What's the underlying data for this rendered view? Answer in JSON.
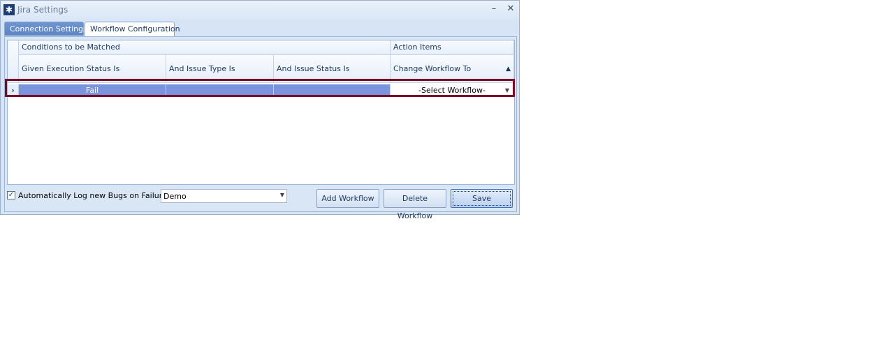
{
  "window": {
    "title": "Jira Settings"
  },
  "title_buttons": {
    "minimize": "–",
    "close": "✕"
  },
  "tabs": [
    {
      "label": "Connection Settings",
      "active": false
    },
    {
      "label": "Workflow Configuration",
      "active": true
    }
  ],
  "grid": {
    "group_headers": {
      "conditions": "Conditions to be Matched",
      "actions": "Action Items"
    },
    "columns": [
      "Given Execution Status Is",
      "And Issue Type Is",
      "And Issue Status Is",
      "Change Workflow To"
    ],
    "sort_indicator": "▲",
    "rows": [
      {
        "indicator": "›",
        "execution_status": "Fail",
        "issue_type": "",
        "issue_status": "",
        "workflow": "-Select Workflow-"
      }
    ]
  },
  "footer": {
    "auto_log_checked": true,
    "auto_log_label": "Automatically Log new Bugs on Failure",
    "project_value": "Demo",
    "add_label": "Add Workflow",
    "delete_label": "Delete Workflow",
    "save_label": "Save"
  },
  "icons": {
    "app": "jira-icon",
    "dropdown": "chevron-down-icon",
    "check": "check-icon"
  },
  "colors": {
    "selected_row": "#7b94de",
    "highlight_border": "#7a0b25",
    "tab_inactive": "#6e95cf"
  }
}
